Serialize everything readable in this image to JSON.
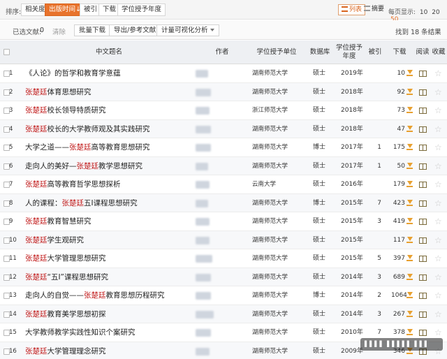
{
  "sort_bar": {
    "label": "排序:",
    "buttons": [
      {
        "label": "相关度",
        "active": false
      },
      {
        "label": "出版时间↓",
        "active": true
      },
      {
        "label": "被引",
        "active": false
      },
      {
        "label": "下载",
        "active": false
      },
      {
        "label": "学位授予年度",
        "active": false
      }
    ],
    "view_list": "列表",
    "view_abstract": "摘要",
    "per_page_label": "每页显示:",
    "per_page_options": [
      "10",
      "20",
      "50"
    ],
    "per_page_selected": "50"
  },
  "toolbar": {
    "selected_label": "已选文献:",
    "selected_count": "0",
    "clear_label": "清除",
    "batch_download": "批量下载",
    "export": "导出/参考文献",
    "visualize": "计量可视化分析",
    "found_text": "找到 18 条结果"
  },
  "table": {
    "headers": {
      "title": "中文题名",
      "author": "作者",
      "unit": "学位授予单位",
      "db": "数据库",
      "year": "学位授予年度",
      "cite": "被引",
      "download": "下载",
      "read": "阅读",
      "fav": "收藏"
    },
    "rows": [
      {
        "num": "1",
        "pre": "《人论》的哲学和教育学意蕴",
        "hl": "",
        "post": "",
        "unit": "湖南师范大学",
        "db": "硕士",
        "year": "2019年",
        "cite": "",
        "dl": "10"
      },
      {
        "num": "2",
        "pre": "",
        "hl": "张楚廷",
        "post": "体育思想研究",
        "unit": "湖南师范大学",
        "db": "硕士",
        "year": "2018年",
        "cite": "",
        "dl": "92"
      },
      {
        "num": "3",
        "pre": "",
        "hl": "张楚廷",
        "post": "校长领导特质研究",
        "unit": "浙江师范大学",
        "db": "硕士",
        "year": "2018年",
        "cite": "",
        "dl": "73"
      },
      {
        "num": "4",
        "pre": "",
        "hl": "张楚廷",
        "post": "校长的大学教师观及其实践研究",
        "unit": "湖南师范大学",
        "db": "硕士",
        "year": "2018年",
        "cite": "",
        "dl": "47"
      },
      {
        "num": "5",
        "pre": "大学之道——",
        "hl": "张楚廷",
        "post": "高等教育思想研究",
        "unit": "湖南师范大学",
        "db": "博士",
        "year": "2017年",
        "cite": "1",
        "dl": "175"
      },
      {
        "num": "6",
        "pre": "走向人的美好—",
        "hl": "张楚廷",
        "post": "教学思想研究",
        "unit": "湖南师范大学",
        "db": "硕士",
        "year": "2017年",
        "cite": "1",
        "dl": "50"
      },
      {
        "num": "7",
        "pre": "",
        "hl": "张楚廷",
        "post": "高等教育哲学思想探析",
        "unit": "云南大学",
        "db": "硕士",
        "year": "2016年",
        "cite": "",
        "dl": "179"
      },
      {
        "num": "8",
        "pre": "人的课程：",
        "hl": "张楚廷",
        "post": "五Ⅰ课程思想研究",
        "unit": "湖南师范大学",
        "db": "博士",
        "year": "2015年",
        "cite": "7",
        "dl": "423"
      },
      {
        "num": "9",
        "pre": "",
        "hl": "张楚廷",
        "post": "教育智慧研究",
        "unit": "湖南师范大学",
        "db": "硕士",
        "year": "2015年",
        "cite": "3",
        "dl": "419"
      },
      {
        "num": "10",
        "pre": "",
        "hl": "张楚廷",
        "post": "学生观研究",
        "unit": "湖南师范大学",
        "db": "硕士",
        "year": "2015年",
        "cite": "",
        "dl": "117"
      },
      {
        "num": "11",
        "pre": "",
        "hl": "张楚廷",
        "post": "大学管理思想研究",
        "unit": "湖南师范大学",
        "db": "硕士",
        "year": "2015年",
        "cite": "5",
        "dl": "397"
      },
      {
        "num": "12",
        "pre": "",
        "hl": "张楚廷",
        "post": "“五Ⅰ”课程思想研究",
        "unit": "湖南师范大学",
        "db": "硕士",
        "year": "2014年",
        "cite": "3",
        "dl": "689"
      },
      {
        "num": "13",
        "pre": "走向人的自觉——",
        "hl": "张楚廷",
        "post": "教育思想历程研究",
        "unit": "湖南师范大学",
        "db": "博士",
        "year": "2014年",
        "cite": "2",
        "dl": "1064"
      },
      {
        "num": "14",
        "pre": "",
        "hl": "张楚廷",
        "post": "教育美学思想初探",
        "unit": "湖南师范大学",
        "db": "硕士",
        "year": "2014年",
        "cite": "3",
        "dl": "267"
      },
      {
        "num": "15",
        "pre": "大学教师教学实践性知识个案研究",
        "hl": "",
        "post": "",
        "unit": "湖南师范大学",
        "db": "硕士",
        "year": "2010年",
        "cite": "7",
        "dl": "378"
      },
      {
        "num": "16",
        "pre": "",
        "hl": "张楚廷",
        "post": "大学管理理念研究",
        "unit": "湖南师范大学",
        "db": "硕士",
        "year": "2009年",
        "cite": "",
        "dl": "346"
      }
    ]
  },
  "icons": {
    "download": "download-icon",
    "read": "book-icon",
    "fav": "star-icon"
  },
  "colors": {
    "accent": "#e8732c",
    "highlight": "#c01818"
  }
}
